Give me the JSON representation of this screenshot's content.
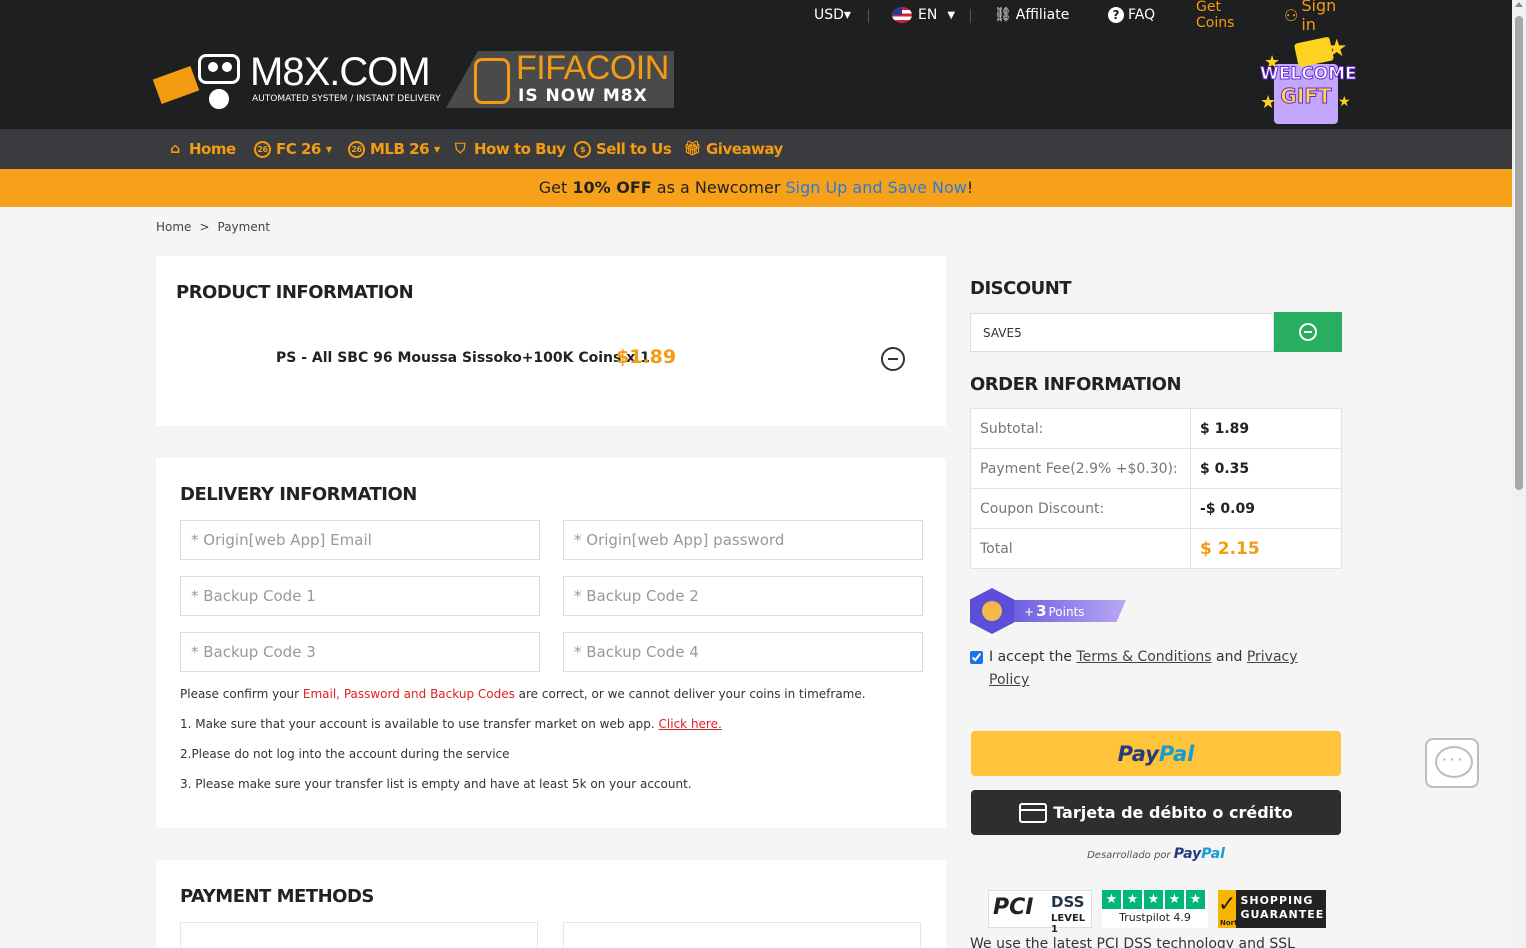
{
  "header": {
    "currency": "USD▾",
    "language": "EN",
    "affiliate": "Affiliate",
    "faq": "FAQ",
    "get_coins": "Get Coins",
    "sign_in": "Sign in",
    "logo_main": "M8X.COM",
    "logo_tagline": "AUTOMATED SYSTEM / INSTANT DELIVERY",
    "logo_fifa": "FIFACOIN",
    "logo_fifa_sub": "IS NOW M8X",
    "gift_line1": "WELCOME",
    "gift_line2": "GIFT"
  },
  "nav": {
    "items": [
      {
        "label": "Home",
        "icon": "home-icon"
      },
      {
        "label": "FC 26",
        "icon": "coin-icon"
      },
      {
        "label": "MLB 26",
        "icon": "coin-icon"
      },
      {
        "label": "How to Buy",
        "icon": "basket-icon"
      },
      {
        "label": "Sell to Us",
        "icon": "dollar-coin-icon"
      },
      {
        "label": "Giveaway",
        "icon": "gift-icon"
      }
    ]
  },
  "promo": {
    "prefix": "Get ",
    "highlight": "10% OFF",
    "middle": " as a Newcomer ",
    "link": "Sign Up and Save Now",
    "suffix": "!"
  },
  "breadcrumb": {
    "home": "Home",
    "separator": ">",
    "current": "Payment"
  },
  "product": {
    "title": "PRODUCT INFORMATION",
    "name": "PS - All SBC 96 Moussa Sissoko+100K Coins x 1",
    "price": "$1.89"
  },
  "delivery": {
    "title": "DELIVERY INFORMATION",
    "fields": [
      {
        "placeholder": "* Origin[web App] Email"
      },
      {
        "placeholder": "* Origin[web App] password"
      },
      {
        "placeholder": "* Backup Code 1"
      },
      {
        "placeholder": "* Backup Code 2"
      },
      {
        "placeholder": "* Backup Code 3"
      },
      {
        "placeholder": "* Backup Code 4"
      }
    ],
    "confirm_prefix": "Please confirm your ",
    "confirm_red": "Email, Password and Backup Codes",
    "confirm_suffix": " are correct, or we cannot deliver your coins in timeframe.",
    "note1": "1. Make sure that your account is available to use transfer market on web app. ",
    "note1_link": "Click here.",
    "note2": "2.Please do not log into the account during the service",
    "note3": "3. Please make sure your transfer list is empty and have at least 5k on your account."
  },
  "payment": {
    "title": "PAYMENT METHODS"
  },
  "discount": {
    "title": "DISCOUNT",
    "code": "SAVE5"
  },
  "order": {
    "title": "ORDER INFORMATION",
    "rows": [
      {
        "label": "Subtotal:",
        "value": "$ 1.89"
      },
      {
        "label": "Payment Fee(2.9% +$0.30):",
        "value": "$ 0.35"
      },
      {
        "label": "Coupon Discount:",
        "value": "-$ 0.09"
      },
      {
        "label": "Total",
        "value": "$ 2.15"
      }
    ]
  },
  "points": {
    "prefix": "+",
    "value": "3",
    "suffix": "Points"
  },
  "terms": {
    "checked": true,
    "prefix": "I accept the ",
    "terms_link": "Terms & Conditions",
    "and": " and ",
    "privacy_link1": "Privacy",
    "privacy_link2": "Policy"
  },
  "paypal": {
    "button_pay": "Pay",
    "button_pal": "Pal",
    "card_button": "Tarjeta de débito o crédito",
    "powered_prefix": "Desarrollado por",
    "powered_pay": "Pay",
    "powered_pal": "Pal"
  },
  "badges": {
    "pci": "PCI",
    "dss": "DSS",
    "level": "LEVEL 1",
    "trustpilot": "Trustpilot 4.9",
    "norton_label": "Norton",
    "norton": "SHOPPING GUARANTEE"
  },
  "security_text": "We use the latest PCI DSS technology and SSL",
  "colors": {
    "accent": "#f39c12",
    "header": "#1e1f21",
    "nav": "#3a3b3e",
    "promo": "#f7a11a",
    "green": "#27ae60",
    "paypal_yellow": "#ffc439"
  }
}
